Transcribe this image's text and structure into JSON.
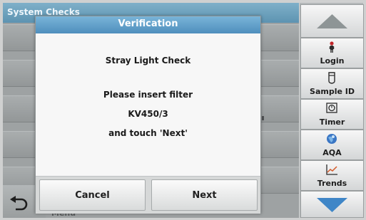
{
  "background": {
    "title": "System Checks",
    "menu_label": "Menu"
  },
  "dialog": {
    "title": "Verification",
    "heading": "Stray Light Check",
    "line1": "Please insert filter",
    "line2": "KV450/3",
    "line3": "and touch 'Next'",
    "cancel_label": "Cancel",
    "next_label": "Next"
  },
  "sidebar": {
    "items": [
      {
        "label": "Login",
        "icon": "person-icon"
      },
      {
        "label": "Sample ID",
        "icon": "sample-vial-icon"
      },
      {
        "label": "Timer",
        "icon": "timer-icon"
      },
      {
        "label": "AQA",
        "icon": "aqa-globe-icon"
      },
      {
        "label": "Trends",
        "icon": "trends-chart-icon"
      }
    ]
  },
  "colors": {
    "dialog_title_bg": "#5f9dc8",
    "arrow_blue": "#3f86c7"
  }
}
